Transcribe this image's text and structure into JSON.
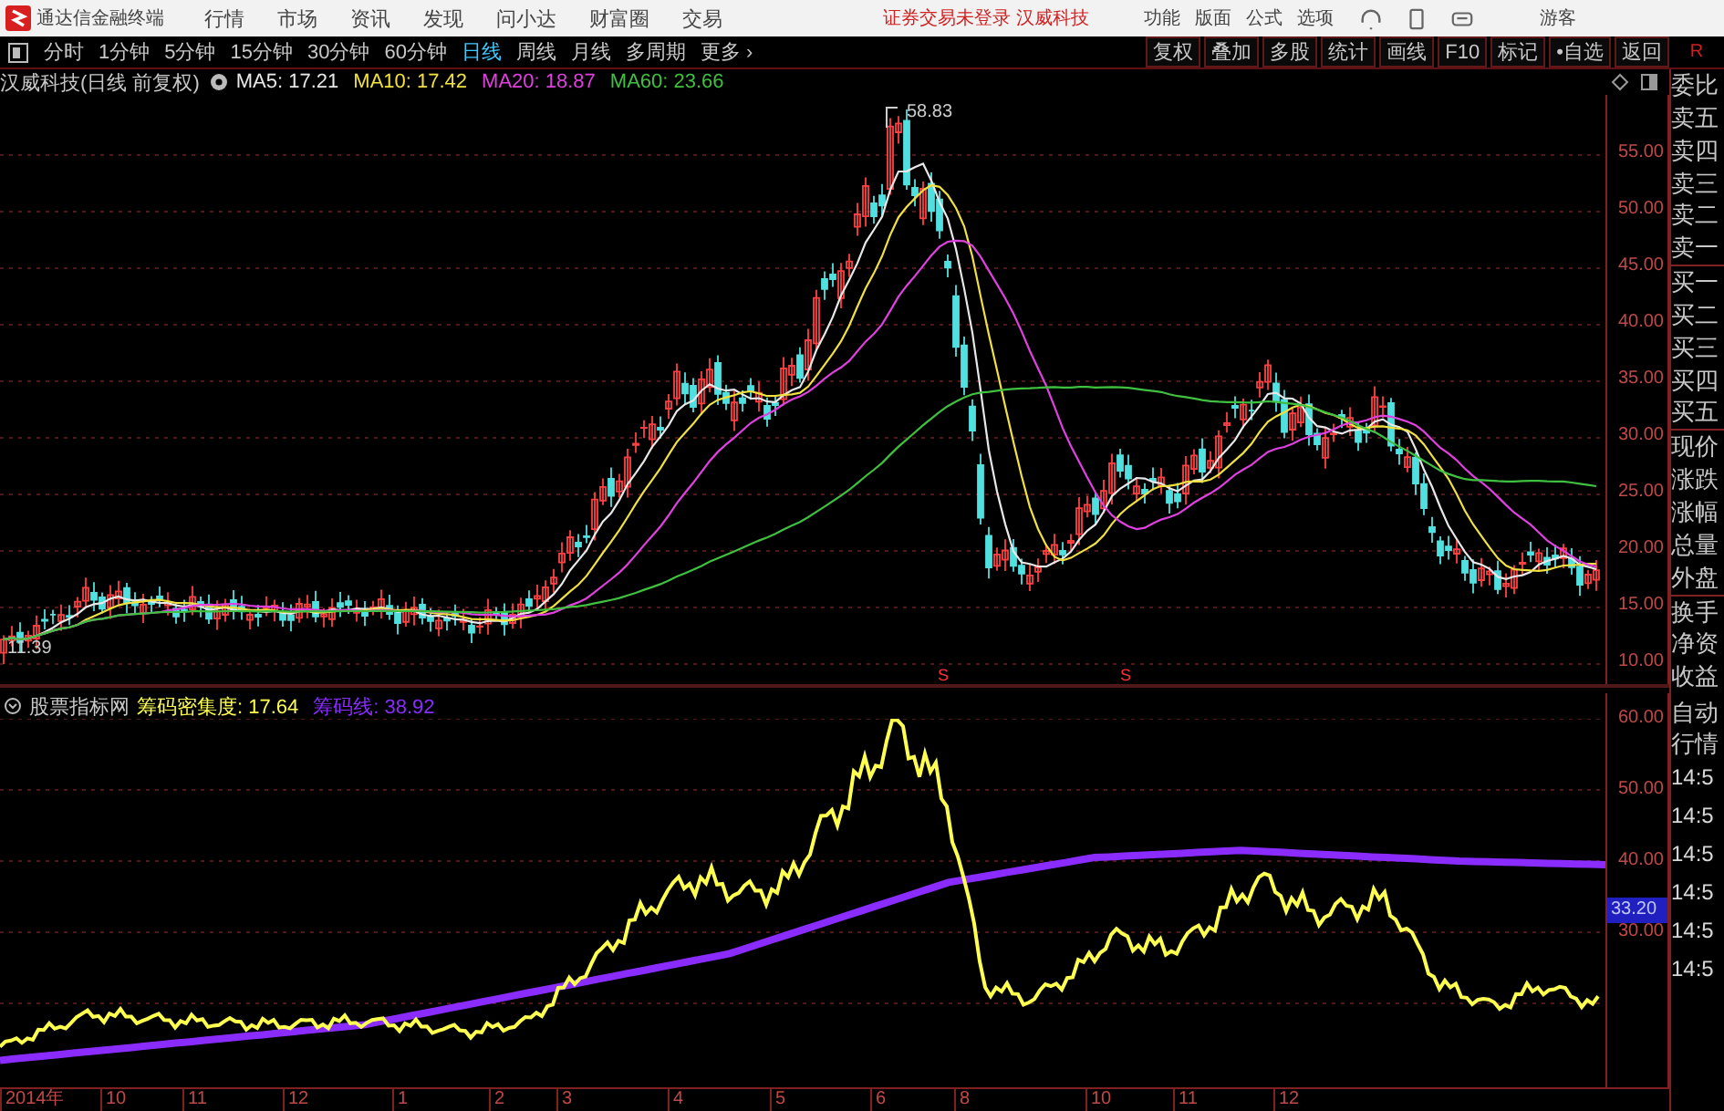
{
  "title_bar": {
    "app_name": "通达信金融终端",
    "menu": [
      "行情",
      "市场",
      "资讯",
      "发现",
      "问小达",
      "财富圈",
      "交易"
    ],
    "status": "证券交易未登录 汉威科技",
    "right_menu": [
      "功能",
      "版面",
      "公式",
      "选项"
    ],
    "user": "游客"
  },
  "toolbar": {
    "periods": [
      {
        "label": "分时",
        "selected": false
      },
      {
        "label": "1分钟",
        "selected": false
      },
      {
        "label": "5分钟",
        "selected": false
      },
      {
        "label": "15分钟",
        "selected": false
      },
      {
        "label": "30分钟",
        "selected": false
      },
      {
        "label": "60分钟",
        "selected": false
      },
      {
        "label": "日线",
        "selected": true
      },
      {
        "label": "周线",
        "selected": false
      },
      {
        "label": "月线",
        "selected": false
      },
      {
        "label": "多周期",
        "selected": false
      },
      {
        "label": "更多 ›",
        "selected": false
      }
    ],
    "buttons": [
      "复权",
      "叠加",
      "多股",
      "统计",
      "画线",
      "F10",
      "标记",
      "•自选",
      "返回"
    ],
    "corner": "R"
  },
  "main_chart": {
    "title": "汉威科技(日线 前复权)",
    "indicators": [
      {
        "label": "MA5: 17.21",
        "color": "#e8e8e8"
      },
      {
        "label": "MA10: 17.42",
        "color": "#f0e040"
      },
      {
        "label": "MA20: 18.87",
        "color": "#e040e0"
      },
      {
        "label": "MA60: 23.66",
        "color": "#40c040"
      }
    ],
    "high_label": "58.83",
    "low_label": "11.39",
    "signals": [
      "S",
      "S"
    ],
    "y_axis": [
      "55.00",
      "50.00",
      "45.00",
      "40.00",
      "35.00",
      "30.00",
      "25.00",
      "20.00",
      "15.00",
      "10.00"
    ]
  },
  "indicator_chart": {
    "title": "股票指标网",
    "indicators": [
      {
        "label": "筹码密集度: 17.64",
        "color": "#ffff50"
      },
      {
        "label": "筹码线: 38.92",
        "color": "#8a2cff"
      }
    ],
    "y_axis": [
      {
        "label": "60.00",
        "kind": "tick"
      },
      {
        "label": "50.00",
        "kind": "tick"
      },
      {
        "label": "40.00",
        "kind": "tick"
      },
      {
        "label": "33.20",
        "kind": "current"
      },
      {
        "label": "30.00",
        "kind": "tick"
      }
    ]
  },
  "x_axis": [
    "2014年",
    "10",
    "11",
    "12",
    "1",
    "2",
    "3",
    "4",
    "5",
    "6",
    "8",
    "10",
    "11",
    "12"
  ],
  "side_panel": {
    "quote_labels": [
      "委比",
      "卖五",
      "卖四",
      "卖三",
      "卖二",
      "卖一",
      "买一",
      "买二",
      "买三",
      "买四",
      "买五",
      "现价",
      "涨跌",
      "涨幅",
      "总量",
      "外盘",
      "换手",
      "净资",
      "收益"
    ],
    "tape_headers": [
      "自动",
      "行情"
    ],
    "tape_times": [
      "14:5",
      "14:5",
      "14:5",
      "14:5",
      "14:5",
      "14:5"
    ]
  }
}
